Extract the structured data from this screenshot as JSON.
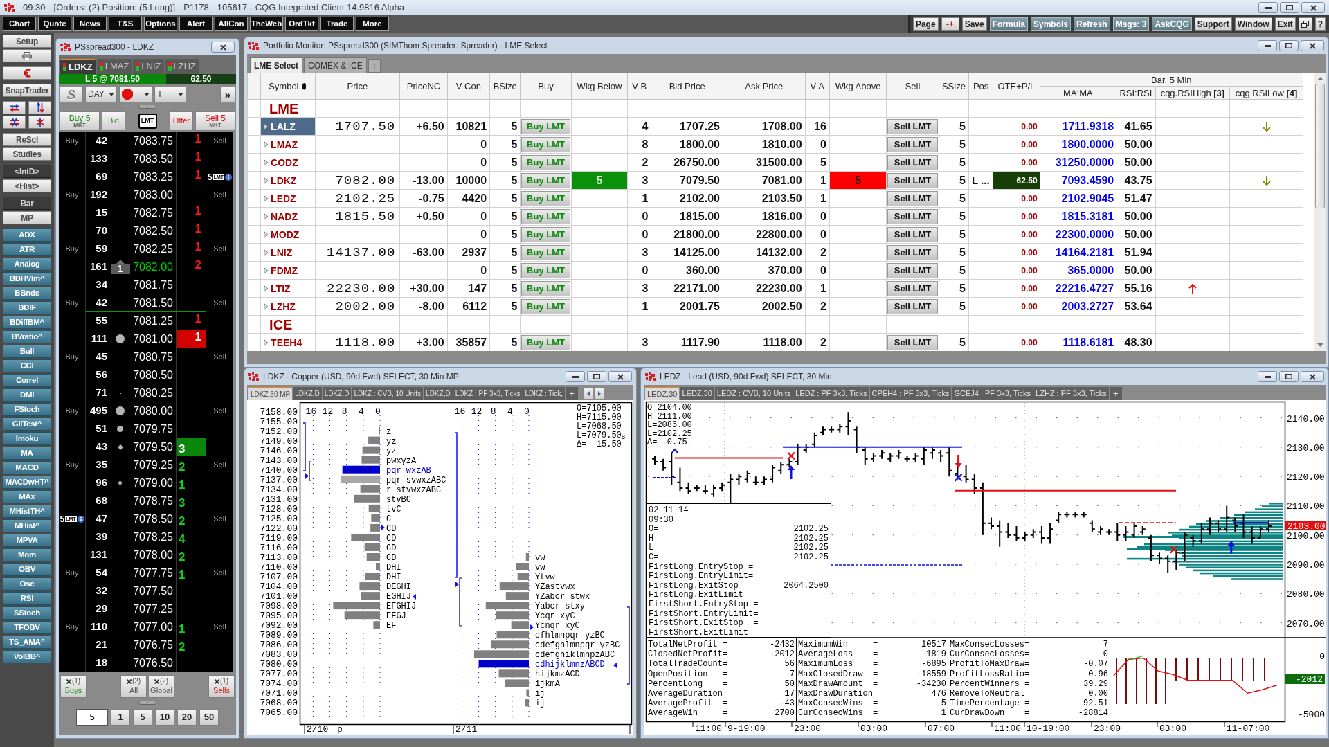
{
  "title_bar": {
    "segments": [
      "09:30",
      "[Orders: (2) Position: (5 Long)]",
      "P1178",
      "105617 - CQG Integrated Client 14.9816 Alpha"
    ]
  },
  "menu_bar": {
    "left": [
      "Chart",
      "Quote",
      "News",
      "T&S",
      "Options",
      "Alert",
      "AllCon",
      "TheWeb",
      "OrdTkt",
      "Trade",
      "More"
    ],
    "right": [
      {
        "label": "Page",
        "kind": "light"
      },
      {
        "label": "-+",
        "kind": "pm"
      },
      {
        "label": "Save",
        "kind": "light"
      },
      {
        "label": "Formula",
        "kind": "slate"
      },
      {
        "label": "Symbols",
        "kind": "slate"
      },
      {
        "label": "Refresh",
        "kind": "slate"
      },
      {
        "label": "Msgs: 3",
        "kind": "slate"
      },
      {
        "label": "AskCQG",
        "kind": "slate"
      },
      {
        "label": "Support",
        "kind": "light"
      },
      {
        "label": "Window",
        "kind": "light"
      },
      {
        "label": "Exit",
        "kind": "light"
      },
      {
        "kind": "restore"
      },
      {
        "label": "?",
        "kind": "light"
      }
    ]
  },
  "sidebar": {
    "groups": [
      [
        {
          "kind": "light",
          "label": "Setup"
        },
        {
          "kind": "printer"
        }
      ],
      [
        {
          "kind": "currency"
        }
      ],
      [
        {
          "kind": "light",
          "label": "SnapTrader"
        }
      ],
      [
        {
          "kind": "swap"
        },
        {
          "kind": "cross"
        }
      ],
      [
        {
          "kind": "light",
          "label": "ReScl"
        },
        {
          "kind": "light",
          "label": "Studies"
        }
      ],
      [
        {
          "kind": "dark",
          "label": "<IntD>"
        },
        {
          "kind": "light",
          "label": "<Hist>"
        }
      ],
      [
        {
          "kind": "dark",
          "label": "Bar"
        },
        {
          "kind": "light",
          "label": "MP"
        }
      ],
      [
        {
          "kind": "study",
          "label": "ADX"
        },
        {
          "kind": "study",
          "label": "ATR"
        },
        {
          "kind": "study",
          "label": "Analog"
        },
        {
          "kind": "study",
          "label": "BBHVlm^"
        },
        {
          "kind": "study",
          "label": "BBnds"
        },
        {
          "kind": "study",
          "label": "BDIF"
        },
        {
          "kind": "study",
          "label": "BDiffBM^"
        },
        {
          "kind": "study",
          "label": "BVratio^"
        },
        {
          "kind": "study",
          "label": "Bull"
        },
        {
          "kind": "study",
          "label": "CCI"
        },
        {
          "kind": "study",
          "label": "Correl"
        },
        {
          "kind": "study",
          "label": "DMI"
        },
        {
          "kind": "study",
          "label": "FStoch"
        },
        {
          "kind": "study",
          "label": "GilTest^"
        },
        {
          "kind": "study",
          "label": "Imoku"
        },
        {
          "kind": "study",
          "label": "MA"
        },
        {
          "kind": "study",
          "label": "MACD"
        },
        {
          "kind": "study",
          "label": "MACDwHT^"
        },
        {
          "kind": "study",
          "label": "MAx"
        },
        {
          "kind": "study",
          "label": "MHistTH^"
        },
        {
          "kind": "study",
          "label": "MHist^"
        },
        {
          "kind": "study",
          "label": "MPVA"
        },
        {
          "kind": "study",
          "label": "Mom"
        },
        {
          "kind": "study",
          "label": "OBV"
        },
        {
          "kind": "study",
          "label": "Osc"
        },
        {
          "kind": "study",
          "label": "RSI"
        },
        {
          "kind": "study",
          "label": "SStoch"
        },
        {
          "kind": "study",
          "label": "TFOBV"
        },
        {
          "kind": "study",
          "label": "TS_AMA^"
        },
        {
          "kind": "study",
          "label": "VolBB^"
        }
      ]
    ]
  },
  "dom": {
    "title": "PSspread300 - LDKZ",
    "tabs": [
      {
        "label": "LDKZ",
        "selected": true
      },
      {
        "label": "LMAZ",
        "selected": false
      },
      {
        "label": "LNIZ",
        "selected": false
      },
      {
        "label": "LZHZ",
        "selected": false
      }
    ],
    "position_bar": {
      "text": "L 5 @ 7081.50",
      "ote": "62.50"
    },
    "controls": {
      "s_label": "S",
      "duration": "DAY",
      "t_label": "T",
      "more": "»"
    },
    "action_buttons": [
      {
        "kind": "buy",
        "label": "Buy 5",
        "sub": "MKT"
      },
      {
        "kind": "bid",
        "label": "Bid"
      },
      {
        "kind": "lmt",
        "label": "LMT"
      },
      {
        "kind": "offer",
        "label": "Offer"
      },
      {
        "kind": "sell",
        "label": "Sell 5",
        "sub": "MKT"
      }
    ],
    "ladder": [
      {
        "buy_label": "Buy",
        "volume": "42",
        "price": "7083.75",
        "size": {
          "kind": "ask",
          "text": "1"
        },
        "sell_label": "Sell",
        "last": false,
        "position": false
      },
      {
        "volume": "133",
        "price": "7083.50",
        "size": {
          "kind": "ask",
          "text": "1"
        },
        "last": false,
        "position": false
      },
      {
        "volume": "69",
        "price": "7083.25",
        "size": {
          "kind": "ask",
          "text": "1"
        },
        "order": {
          "kind": "sell",
          "qty": "5",
          "type": "LMT"
        },
        "last": false,
        "position": false
      },
      {
        "buy_label": "Buy",
        "volume": "192",
        "price": "7083.00",
        "sell_label": "Sell",
        "last": false,
        "position": false
      },
      {
        "volume": "15",
        "price": "7082.75",
        "size": {
          "kind": "ask",
          "text": "1"
        },
        "last": false,
        "position": false
      },
      {
        "volume": "70",
        "price": "7082.50",
        "size": {
          "kind": "ask",
          "text": "1"
        },
        "last": false,
        "position": false
      },
      {
        "buy_label": "Buy",
        "volume": "59",
        "price": "7082.25",
        "size": {
          "kind": "ask",
          "text": "1"
        },
        "sell_label": "Sell",
        "last": false,
        "position": false
      },
      {
        "volume": "161",
        "marker": {
          "kind": "trade",
          "text": "1"
        },
        "price": "7082.00",
        "size": {
          "kind": "ask",
          "text": "2"
        },
        "last": true,
        "position": false
      },
      {
        "volume": "34",
        "price": "7081.75",
        "last": false,
        "position": false
      },
      {
        "buy_label": "Buy",
        "volume": "42",
        "price": "7081.50",
        "sell_label": "Sell",
        "last": false,
        "position": true
      },
      {
        "volume": "55",
        "price": "7081.25",
        "size": {
          "kind": "ask",
          "text": "1"
        },
        "last": false,
        "position": false
      },
      {
        "volume": "111",
        "marker": {
          "kind": "large"
        },
        "price": "7081.00",
        "size": {
          "kind": "bestask",
          "text": "1"
        },
        "last": false,
        "position": false
      },
      {
        "buy_label": "Buy",
        "volume": "45",
        "price": "7080.75",
        "sell_label": "Sell",
        "last": false,
        "position": false
      },
      {
        "volume": "56",
        "price": "7080.50",
        "last": false,
        "position": false
      },
      {
        "volume": "71",
        "marker": {
          "kind": "tiny"
        },
        "price": "7080.25",
        "last": false,
        "position": false
      },
      {
        "buy_label": "Buy",
        "volume": "495",
        "marker": {
          "kind": "large"
        },
        "price": "7080.00",
        "sell_label": "Sell",
        "last": false,
        "position": false
      },
      {
        "volume": "51",
        "marker": {
          "kind": "medium"
        },
        "price": "7079.75",
        "last": false,
        "position": false
      },
      {
        "volume": "43",
        "marker": {
          "kind": "diamond"
        },
        "price": "7079.50",
        "size": {
          "kind": "bestbid",
          "text": "3"
        },
        "last": false,
        "position": false
      },
      {
        "buy_label": "Buy",
        "volume": "35",
        "price": "7079.25",
        "size": {
          "kind": "bid",
          "text": "2"
        },
        "sell_label": "Sell",
        "last": false,
        "position": false
      },
      {
        "volume": "96",
        "marker": {
          "kind": "small"
        },
        "price": "7079.00",
        "size": {
          "kind": "bid",
          "text": "1"
        },
        "last": false,
        "position": false
      },
      {
        "volume": "68",
        "price": "7078.75",
        "size": {
          "kind": "bid",
          "text": "3"
        },
        "last": false,
        "position": false
      },
      {
        "order": {
          "kind": "buy",
          "qty": "5",
          "type": "LMT"
        },
        "volume": "47",
        "price": "7078.50",
        "size": {
          "kind": "bid",
          "text": "2"
        },
        "sell_label": "Sell",
        "last": false,
        "position": false
      },
      {
        "volume": "39",
        "price": "7078.25",
        "size": {
          "kind": "bid",
          "text": "4"
        },
        "last": false,
        "position": false
      },
      {
        "volume": "131",
        "price": "7078.00",
        "size": {
          "kind": "bid",
          "text": "2"
        },
        "last": false,
        "position": false
      },
      {
        "buy_label": "Buy",
        "volume": "54",
        "price": "7077.75",
        "size": {
          "kind": "bid",
          "text": "1"
        },
        "sell_label": "Sell",
        "last": false,
        "position": false
      },
      {
        "volume": "32",
        "price": "7077.50",
        "last": false,
        "position": false
      },
      {
        "volume": "29",
        "price": "7077.25",
        "last": false,
        "position": false
      },
      {
        "buy_label": "Buy",
        "volume": "110",
        "price": "7077.00",
        "size": {
          "kind": "bid",
          "text": "1"
        },
        "sell_label": "Sell",
        "last": false,
        "position": false
      },
      {
        "volume": "21",
        "price": "7076.75",
        "size": {
          "kind": "bid",
          "text": "2"
        },
        "last": false,
        "position": false
      },
      {
        "volume": "18",
        "price": "7076.50",
        "last": false,
        "position": false
      }
    ],
    "cancel_buttons": [
      {
        "kind": "buys",
        "count": "(1)",
        "label": "Buys"
      },
      {
        "kind": "all",
        "count": "(2)",
        "label": "All"
      },
      {
        "kind": "global",
        "count": "(2)",
        "label": "Global"
      },
      {
        "kind": "sells",
        "count": "(1)",
        "label": "Sells"
      }
    ],
    "quantity": {
      "value": "5",
      "presets": [
        "1",
        "5",
        "10",
        "20",
        "50"
      ]
    }
  },
  "portfolio": {
    "title": "Portfolio Monitor: PSspread300 (SIMThom Spreader: Spreader) - LME Select",
    "tabs": [
      {
        "label": "LME Select",
        "selected": true
      },
      {
        "label": "COMEX & ICE",
        "selected": false
      }
    ],
    "add_tab": "+",
    "columns": [
      "Symbol",
      "Price",
      "PriceNC",
      "V Con",
      "BSize",
      "Buy",
      "Wkg Below",
      "V B",
      "Bid Price",
      "Ask Price",
      "V A",
      "Wkg Above",
      "Sell",
      "SSize",
      "Pos",
      "OTE+P/L"
    ],
    "group_header": "Bar, 5 Min",
    "group_columns": [
      "MA:MA",
      "RSI:RSI",
      "cqg.RSIHigh **[3]**",
      "cqg.RSILow **[4]**"
    ],
    "rows": [
      {
        "kind": "group",
        "label": "LME"
      },
      {
        "kind": "symbol",
        "symbol": "LALZ",
        "selected": true,
        "price": "1707.50",
        "price_nc": "+6.50",
        "v_con": "10821",
        "bsize": "5",
        "buy": "Buy LMT",
        "vb": "4",
        "bid": "1707.25",
        "ask": "1708.00",
        "va": "16",
        "sell": "Sell LMT",
        "ssize": "5",
        "gain": false,
        "ote": "0.00",
        "ma": "1711.9318",
        "rsi": "41.65",
        "rsi_high_signal": false,
        "rsi_low_signal": true
      },
      {
        "kind": "symbol",
        "symbol": "LMAZ",
        "selected": false,
        "v_con": "0",
        "bsize": "5",
        "buy": "Buy LMT",
        "vb": "8",
        "bid": "1800.00",
        "ask": "1810.00",
        "va": "0",
        "sell": "Sell LMT",
        "ssize": "5",
        "gain": false,
        "ote": "0.00",
        "ma": "1800.0000",
        "rsi": "50.00",
        "rsi_high_signal": false,
        "rsi_low_signal": false
      },
      {
        "kind": "symbol",
        "symbol": "CODZ",
        "selected": false,
        "v_con": "0",
        "bsize": "5",
        "buy": "Buy LMT",
        "vb": "2",
        "bid": "26750.00",
        "ask": "31500.00",
        "va": "5",
        "sell": "Sell LMT",
        "ssize": "5",
        "gain": false,
        "ote": "0.00",
        "ma": "31250.0000",
        "rsi": "50.00",
        "rsi_high_signal": false,
        "rsi_low_signal": false
      },
      {
        "kind": "symbol",
        "symbol": "LDKZ",
        "selected": false,
        "price": "7082.00",
        "price_nc": "-13.00",
        "v_con": "10000",
        "bsize": "5",
        "buy": "Buy LMT",
        "wkg_below": "5",
        "vb": "3",
        "bid": "7079.50",
        "ask": "7081.00",
        "va": "1",
        "wkg_above": "5",
        "sell": "Sell LMT",
        "ssize": "5",
        "pos": "L ...",
        "gain": true,
        "ote": "62.50",
        "ma": "7093.4590",
        "rsi": "43.75",
        "rsi_high_signal": false,
        "rsi_low_signal": true
      },
      {
        "kind": "symbol",
        "symbol": "LEDZ",
        "selected": false,
        "price": "2102.25",
        "price_nc": "-0.75",
        "v_con": "4420",
        "bsize": "5",
        "buy": "Buy LMT",
        "vb": "1",
        "bid": "2102.00",
        "ask": "2103.50",
        "va": "1",
        "sell": "Sell LMT",
        "ssize": "5",
        "gain": false,
        "ote": "0.00",
        "ma": "2102.9045",
        "rsi": "51.47",
        "rsi_high_signal": false,
        "rsi_low_signal": false
      },
      {
        "kind": "symbol",
        "symbol": "NADZ",
        "selected": false,
        "price": "1815.50",
        "price_nc": "+0.50",
        "v_con": "0",
        "bsize": "5",
        "buy": "Buy LMT",
        "vb": "0",
        "bid": "1815.00",
        "ask": "1816.00",
        "va": "0",
        "sell": "Sell LMT",
        "ssize": "5",
        "gain": false,
        "ote": "0.00",
        "ma": "1815.3181",
        "rsi": "50.00",
        "rsi_high_signal": false,
        "rsi_low_signal": false
      },
      {
        "kind": "symbol",
        "symbol": "MODZ",
        "selected": false,
        "v_con": "0",
        "bsize": "5",
        "buy": "Buy LMT",
        "vb": "0",
        "bid": "21800.00",
        "ask": "22800.00",
        "va": "0",
        "sell": "Sell LMT",
        "ssize": "5",
        "gain": false,
        "ote": "0.00",
        "ma": "22300.0000",
        "rsi": "50.00",
        "rsi_high_signal": false,
        "rsi_low_signal": false
      },
      {
        "kind": "symbol",
        "symbol": "LNIZ",
        "selected": false,
        "price": "14137.00",
        "price_nc": "-63.00",
        "v_con": "2937",
        "bsize": "5",
        "buy": "Buy LMT",
        "vb": "3",
        "bid": "14125.00",
        "ask": "14132.00",
        "va": "2",
        "sell": "Sell LMT",
        "ssize": "5",
        "gain": false,
        "ote": "0.00",
        "ma": "14164.2181",
        "rsi": "51.94",
        "rsi_high_signal": false,
        "rsi_low_signal": false
      },
      {
        "kind": "symbol",
        "symbol": "FDMZ",
        "selected": false,
        "v_con": "0",
        "bsize": "5",
        "buy": "Buy LMT",
        "vb": "0",
        "bid": "360.00",
        "ask": "370.00",
        "va": "0",
        "sell": "Sell LMT",
        "ssize": "5",
        "gain": false,
        "ote": "0.00",
        "ma": "365.0000",
        "rsi": "50.00",
        "rsi_high_signal": false,
        "rsi_low_signal": false
      },
      {
        "kind": "symbol",
        "symbol": "LTIZ",
        "selected": false,
        "price": "22230.00",
        "price_nc": "+30.00",
        "v_con": "147",
        "bsize": "5",
        "buy": "Buy LMT",
        "vb": "3",
        "bid": "22171.00",
        "ask": "22230.00",
        "va": "1",
        "sell": "Sell LMT",
        "ssize": "5",
        "gain": false,
        "ote": "0.00",
        "ma": "22216.4727",
        "rsi": "55.16",
        "rsi_high_signal": true,
        "rsi_low_signal": false
      },
      {
        "kind": "symbol",
        "symbol": "LZHZ",
        "selected": false,
        "price": "2002.00",
        "price_nc": "-8.00",
        "v_con": "6112",
        "bsize": "5",
        "buy": "Buy LMT",
        "vb": "1",
        "bid": "2001.75",
        "ask": "2002.50",
        "va": "2",
        "sell": "Sell LMT",
        "ssize": "5",
        "gain": false,
        "ote": "0.00",
        "ma": "2003.2727",
        "rsi": "53.64",
        "rsi_high_signal": false,
        "rsi_low_signal": false
      },
      {
        "kind": "group",
        "label": "ICE"
      },
      {
        "kind": "symbol",
        "symbol": "TEEH4",
        "selected": false,
        "price": "1118.00",
        "price_nc": "+3.00",
        "v_con": "35857",
        "bsize": "5",
        "buy": "Buy LMT",
        "vb": "3",
        "bid": "1117.90",
        "ask": "1118.00",
        "va": "2",
        "sell": "Sell LMT",
        "ssize": "5",
        "gain": false,
        "ote": "0.00",
        "ma": "1118.6181",
        "rsi": "48.30",
        "rsi_high_signal": false,
        "rsi_low_signal": false
      }
    ]
  },
  "profile_chart": {
    "title": "LDKZ - Copper (USD, 90d Fwd) SELECT, 30 Min MP",
    "tabs": [
      {
        "label": "LDKZ,30 MP",
        "selected": true
      },
      {
        "label": "LDKZ,D",
        "selected": false
      },
      {
        "label": "LDKZ,D",
        "selected": false
      },
      {
        "label": "LDKZ : CVB, 10 Units",
        "selected": false
      },
      {
        "label": "LDKZ,D",
        "selected": false
      },
      {
        "label": "LDKZ : PF 3x3, Ticks",
        "selected": false
      },
      {
        "label": "LDKZ : Tick,",
        "selected": false
      }
    ],
    "add_tab": "+",
    "ohlc": [
      "O=7105.00",
      "H=7115.00",
      "L=7068.50",
      "L=7079.50$_{B}$",
      "Δ= -15.50"
    ],
    "sessions": [
      {
        "date": "2/10",
        "note": "p",
        "scale": [
          "16",
          "12",
          "8",
          "4",
          "0"
        ],
        "chart_data": {
          "type": "bar",
          "orientation": "horizontal",
          "stacked": true,
          "grid": true,
          "categories": [
            "7158.00",
            "7155.00",
            "7152.00",
            "7149.00",
            "7146.00",
            "7143.00",
            "7140.00",
            "7137.00",
            "7134.00",
            "7131.00",
            "7128.00",
            "7125.00",
            "7122.00",
            "7119.00",
            "7116.00",
            "7113.00",
            "7110.00",
            "7107.00",
            "7104.00",
            "7101.00",
            "7098.00",
            "7095.00",
            "7092.00",
            "7089.00",
            "7086.00",
            "7083.00",
            "7080.00",
            "7077.00",
            "7074.00",
            "7071.00",
            "7068.00",
            "7065.00"
          ],
          "xticks": [
            16,
            12,
            8,
            4,
            0
          ],
          "xlim": [
            16,
            0
          ],
          "series": [
            {
              "color": "#808080",
              "values": [
                null,
                null,
                0.2,
                2.8,
                4.2,
                4.4,
                null,
                null,
                4.7,
                6.3,
                2.7,
                2.1,
                2.3,
                6.9,
                3.7,
                3.2,
                1,
                3.5,
                4.9,
                4.6,
                11.2,
                8.5,
                1.6,
                null,
                null,
                null,
                null,
                null,
                null,
                null,
                null,
                null
              ]
            },
            {
              "color": "#0000c8",
              "values": [
                null,
                null,
                null,
                null,
                null,
                null,
                9,
                null,
                null,
                null,
                null,
                null,
                null,
                null,
                null,
                null,
                null,
                null,
                null,
                null,
                null,
                null,
                null,
                null,
                null,
                null,
                null,
                null,
                null,
                null,
                null,
                null
              ]
            },
            {
              "color": "#a8a8a8",
              "values": [
                null,
                null,
                null,
                null,
                null,
                null,
                null,
                9.3,
                null,
                null,
                null,
                null,
                null,
                null,
                null,
                null,
                null,
                null,
                null,
                null,
                null,
                null,
                null,
                null,
                null,
                null,
                null,
                null,
                null,
                null,
                null,
                null
              ]
            }
          ],
          "value_labels": [
            null,
            null,
            "z",
            "yz",
            "yz",
            "pwxyzA",
            "pqr wxzAB",
            "pqr svwxzABC",
            "r stvwxzABC",
            "stvBC",
            "tvC",
            "C",
            "CD",
            "CD",
            "CD",
            "CD",
            "DHI",
            "DHI",
            "DEGHI",
            "EGHIJ",
            "EFGHIJ",
            "EFGJ",
            "EF",
            null,
            null,
            null,
            null,
            null,
            null,
            null,
            null,
            null
          ]
        }
      },
      {
        "date": "2/11",
        "scale": [
          "16",
          "12",
          "8",
          "4",
          "0"
        ],
        "chart_data": {
          "type": "bar",
          "orientation": "horizontal",
          "stacked": true,
          "grid": true,
          "categories": [
            null,
            null,
            null,
            null,
            null,
            null,
            null,
            null,
            null,
            null,
            null,
            null,
            null,
            null,
            null,
            null,
            null,
            null,
            null,
            null,
            null,
            null,
            null,
            null,
            null,
            null,
            null,
            null,
            null,
            null,
            null,
            null
          ],
          "xticks": [
            16,
            12,
            8,
            4,
            0
          ],
          "xlim": [
            16,
            0
          ],
          "series": [
            {
              "color": "#808080",
              "values": [
                null,
                null,
                null,
                null,
                null,
                null,
                null,
                null,
                null,
                null,
                null,
                null,
                null,
                null,
                null,
                0.7,
                3,
                2.7,
                7,
                5.5,
                10.3,
                7.9,
                4.2,
                7.7,
                9.1,
                13.1,
                null,
                7.2,
                5.8,
                0.6,
                0.9,
                null
              ]
            },
            {
              "color": "#0000c8",
              "values": [
                null,
                null,
                null,
                null,
                null,
                null,
                null,
                null,
                null,
                null,
                null,
                null,
                null,
                null,
                null,
                null,
                null,
                null,
                null,
                null,
                null,
                null,
                null,
                null,
                null,
                null,
                12,
                null,
                null,
                null,
                null,
                null
              ]
            }
          ],
          "value_labels": [
            null,
            null,
            null,
            null,
            null,
            null,
            null,
            null,
            null,
            null,
            null,
            null,
            null,
            null,
            null,
            "vw",
            "vw",
            "Ytvw",
            "YZastvwx",
            "YZabcr stwx",
            "Yabcr stxy",
            "Ycqr xyC",
            "Ycnqr xyC",
            "cfhlmnpqr yzBC",
            "cdefghlmnpqr yzBC",
            "cdefghiklmnpzABC",
            "cdhijklmnzABCD",
            "hijkmzACD",
            "ijkmA",
            "ij",
            "ij",
            null
          ]
        }
      }
    ]
  },
  "price_chart": {
    "title": "LEDZ - Lead (USD, 90d Fwd) SELECT, 30 Min",
    "tabs": [
      {
        "label": "LEDZ,30",
        "selected": true
      },
      {
        "label": "LEDZ,30",
        "selected": false
      },
      {
        "label": "LEDZ : CVB, 10 Units",
        "selected": false
      },
      {
        "label": "LEDZ : PF 3x3, Ticks",
        "selected": false
      },
      {
        "label": "CPEH4 : PF 3x3, Ticks",
        "selected": false
      },
      {
        "label": "GCEJ4 : PF 3x3, Ticks",
        "selected": false
      },
      {
        "label": "LZHZ : PF 3x3, Ticks",
        "selected": false
      }
    ],
    "add_tab": "+",
    "ohlc": [
      "O=2104.00",
      "H=2111.00",
      "L=2086.00",
      "L=2102.25",
      "Δ= -0.75"
    ],
    "price_ticks": [
      "2140.00",
      "2130.00",
      "2120.00",
      "2110.00",
      "2100.00",
      "2090.00",
      "2080.00",
      "2070.00"
    ],
    "last_price": "2103.00",
    "data_window": {
      "date": "02-11-14",
      "time": "09:30",
      "rows": [
        {
          "label": "O=",
          "value": "2102.25"
        },
        {
          "label": "H=",
          "value": "2102.25"
        },
        {
          "label": "L=",
          "value": "2102.25"
        },
        {
          "label": "C=",
          "value": "2102.25"
        },
        {
          "label": "FirstLong.EntryStop ="
        },
        {
          "label": "FirstLong.EntryLimit="
        },
        {
          "label": "FirstLong.ExitStop  =",
          "value": "2064.2500"
        },
        {
          "label": "FirstLong.ExitLimit ="
        },
        {
          "label": "FirstShort.EntryStop ="
        },
        {
          "label": "FirstShort.EntryLimit="
        },
        {
          "label": "FirstShort.ExitStop  ="
        },
        {
          "label": "FirstShort.ExitLimit ="
        }
      ]
    },
    "performance": [
      [
        {
          "label": "TotalNetProfit =",
          "value": "-2432"
        },
        {
          "label": "ClosedNetProfit=",
          "value": "-2012"
        },
        {
          "label": "TotalTradeCount=",
          "value": "56"
        },
        {
          "label": "OpenPosition   =",
          "value": "7"
        },
        {
          "label": "PercentLong    =",
          "value": "50"
        },
        {
          "label": "AverageDuration=",
          "value": "17"
        },
        {
          "label": "AverageProfit  =",
          "value": "-43"
        },
        {
          "label": "AverageWin     =",
          "value": "2700"
        }
      ],
      [
        {
          "label": "MaximumWin     =",
          "value": "10517"
        },
        {
          "label": "AverageLoss    =",
          "value": "-1819"
        },
        {
          "label": "MaximumLoss    =",
          "value": "-6895"
        },
        {
          "label": "MaxClosedDraw  =",
          "value": "-18559"
        },
        {
          "label": "MaxDrawAmount  =",
          "value": "-34230"
        },
        {
          "label": "MaxDrawDuration=",
          "value": "476"
        },
        {
          "label": "MaxConsecWins  =",
          "value": "5"
        },
        {
          "label": "CurConsecWins  =",
          "value": "1"
        }
      ],
      [
        {
          "label": "MaxConsecLosses=",
          "value": "7"
        },
        {
          "label": "CurConsecLosses=",
          "value": "0"
        },
        {
          "label": "ProfitToMaxDraw=",
          "value": "-0.07"
        },
        {
          "label": "ProfitLossRatio=",
          "value": "0.96"
        },
        {
          "label": "PercentWinners =",
          "value": "39.29"
        },
        {
          "label": "RemoveToNeutral=",
          "value": "0.00"
        },
        {
          "label": "TimePercentage =",
          "value": "92.51"
        },
        {
          "label": "CurDrawDown    =",
          "value": "-28814"
        }
      ]
    ],
    "equity_last": "-2012",
    "equity_chart": {
      "chart_data": {
        "type": "line",
        "categories": [
          null,
          null,
          null,
          null,
          null,
          null,
          null,
          null,
          null,
          null,
          null,
          null
        ],
        "ylim": [
          -5600,
          21700
        ],
        "yticks": [
          0,
          -5000
        ],
        "series": [
          {
            "color": "#e01010",
            "values": [
              -1700,
              -300,
              -200,
              -1300,
              -1600,
              -2100,
              -2100,
              -2100,
              -2100,
              -3200,
              -2900,
              -2500
            ]
          },
          {
            "color": "#20c020",
            "values": [
              null,
              -400,
              0,
              null,
              null,
              null,
              null,
              null,
              null,
              null,
              null,
              null
            ]
          }
        ]
      }
    },
    "time_labels": [
      "11:00",
      "9-19:00",
      "23:00",
      "03:00",
      "07:00",
      "11:00",
      "10-19:00",
      "23:00",
      "03:00",
      "11-07:00"
    ]
  }
}
